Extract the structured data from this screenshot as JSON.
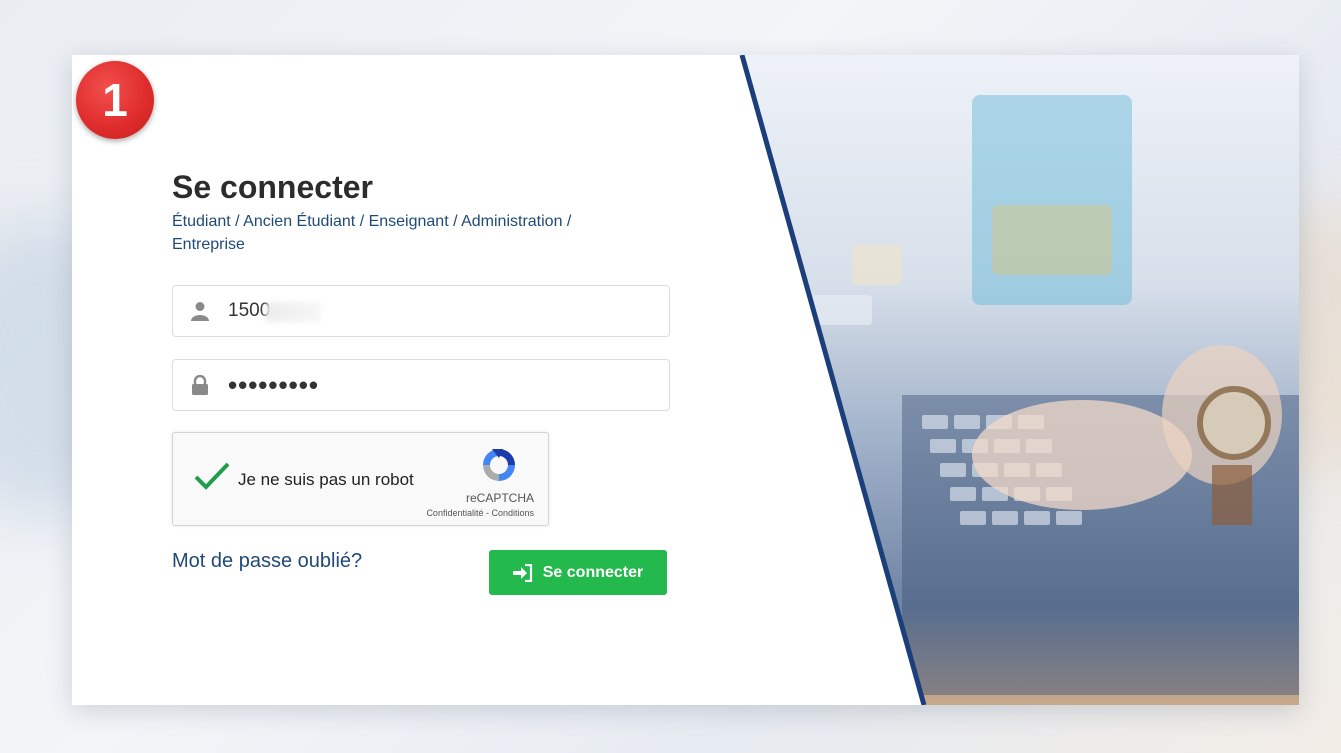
{
  "step_badge": "1",
  "login": {
    "title": "Se connecter",
    "subtitle": "Étudiant / Ancien Étudiant / Enseignant / Administration / Entreprise",
    "username_value": "1500",
    "password_value": "•••••••••",
    "forgot_link": "Mot de passe oublié?",
    "submit_label": "Se connecter"
  },
  "recaptcha": {
    "label": "Je ne suis pas un robot",
    "brand": "reCAPTCHA",
    "terms": "Confidentialité - Conditions",
    "checked": true
  },
  "icons": {
    "username": "user-icon",
    "password": "lock-icon",
    "submit": "sign-in-icon",
    "captcha_check": "checkmark-icon",
    "captcha_logo": "recaptcha-logo-icon"
  },
  "colors": {
    "primary_text": "#1f4a78",
    "button": "#23b94c",
    "badge": "#de2b2b",
    "divider": "#1b3f7a"
  }
}
